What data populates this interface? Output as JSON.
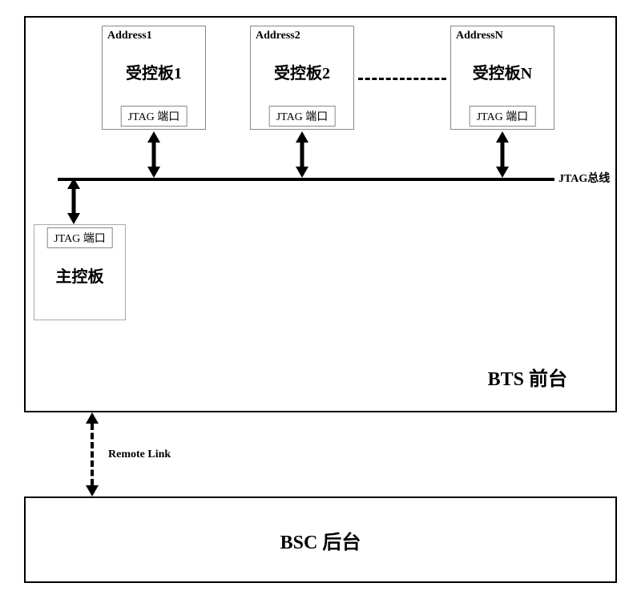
{
  "bts": {
    "label": "BTS 前台",
    "boards": [
      {
        "address": "Address1",
        "title": "受控板1",
        "port": "JTAG 端口"
      },
      {
        "address": "Address2",
        "title": "受控板2",
        "port": "JTAG 端口"
      },
      {
        "address": "AddressN",
        "title": "受控板N",
        "port": "JTAG 端口"
      }
    ],
    "bus_label": "JTAG总线",
    "main_board": {
      "port": "JTAG 端口",
      "title": "主控板"
    }
  },
  "remote_link": {
    "label": "Remote Link"
  },
  "bsc": {
    "label": "BSC 后台"
  }
}
